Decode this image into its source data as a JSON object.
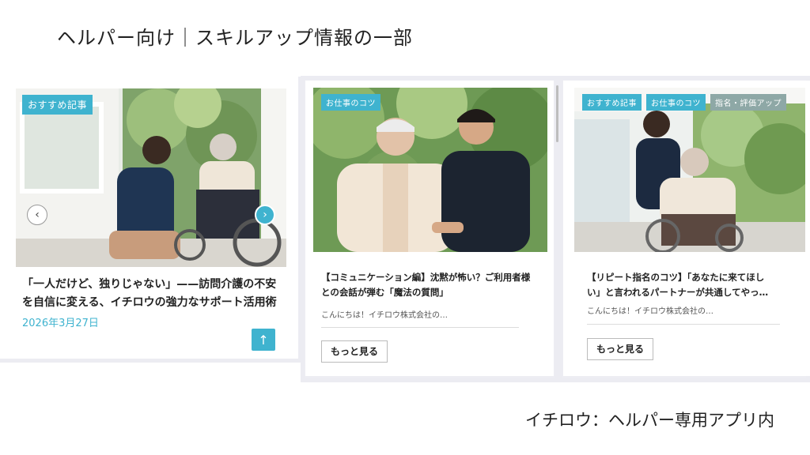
{
  "page": {
    "heading": "ヘルパー向け｜スキルアップ情報の一部",
    "caption": "イチロウ：ヘルパー専用アプリ内"
  },
  "cards": [
    {
      "tags": [
        "おすすめ記事"
      ],
      "title": "「一人だけど、独りじゃない」——訪問介護の不安を自信に変える、イチロウの強力なサポート活用術",
      "date": "2026年3月27日",
      "prev_icon": "chevron-left-icon",
      "next_icon": "chevron-right-icon",
      "top_icon": "arrow-up-icon"
    },
    {
      "tags": [
        "お仕事のコツ"
      ],
      "title": "【コミュニケーション編】沈黙が怖い？ご利用者様との会話が弾む「魔法の質問」",
      "excerpt": "こんにちは！イチロウ株式会社の…",
      "more_label": "もっと見る"
    },
    {
      "tags": [
        "おすすめ記事",
        "お仕事のコツ",
        "指名・評価アップ"
      ],
      "title": "【リピート指名のコツ】「あなたに来てほしい」と言われるパートナーが共通してやっ…",
      "excerpt": "こんにちは！イチロウ株式会社の…",
      "more_label": "もっと見る"
    }
  ],
  "colors": {
    "accent": "#3fb3cf",
    "card_border": "#ececf2"
  }
}
